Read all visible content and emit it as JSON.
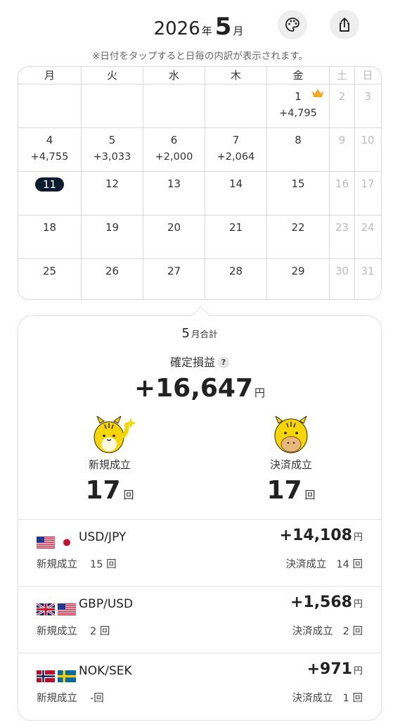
{
  "header": {
    "year": "2026",
    "year_unit": "年",
    "month": "5",
    "month_unit": "月",
    "palette_icon": "palette-icon",
    "share_icon": "share-icon",
    "note": "※日付をタップすると日毎の内訳が表示されます。"
  },
  "calendar": {
    "weekdays": [
      "月",
      "火",
      "水",
      "木",
      "金",
      "土",
      "日"
    ],
    "weeks": [
      [
        {
          "day": "",
          "pnl": ""
        },
        {
          "day": "",
          "pnl": ""
        },
        {
          "day": "",
          "pnl": ""
        },
        {
          "day": "",
          "pnl": ""
        },
        {
          "day": "1",
          "pnl": "+4,795",
          "crown": true
        },
        {
          "day": "2",
          "pnl": ""
        },
        {
          "day": "3",
          "pnl": ""
        }
      ],
      [
        {
          "day": "4",
          "pnl": "+4,755"
        },
        {
          "day": "5",
          "pnl": "+3,033"
        },
        {
          "day": "6",
          "pnl": "+2,000"
        },
        {
          "day": "7",
          "pnl": "+2,064"
        },
        {
          "day": "8",
          "pnl": ""
        },
        {
          "day": "9",
          "pnl": ""
        },
        {
          "day": "10",
          "pnl": ""
        }
      ],
      [
        {
          "day": "11",
          "pnl": "",
          "today": true
        },
        {
          "day": "12",
          "pnl": ""
        },
        {
          "day": "13",
          "pnl": ""
        },
        {
          "day": "14",
          "pnl": ""
        },
        {
          "day": "15",
          "pnl": ""
        },
        {
          "day": "16",
          "pnl": ""
        },
        {
          "day": "17",
          "pnl": ""
        }
      ],
      [
        {
          "day": "18",
          "pnl": ""
        },
        {
          "day": "19",
          "pnl": ""
        },
        {
          "day": "20",
          "pnl": ""
        },
        {
          "day": "21",
          "pnl": ""
        },
        {
          "day": "22",
          "pnl": ""
        },
        {
          "day": "23",
          "pnl": ""
        },
        {
          "day": "24",
          "pnl": ""
        }
      ],
      [
        {
          "day": "25",
          "pnl": ""
        },
        {
          "day": "26",
          "pnl": ""
        },
        {
          "day": "27",
          "pnl": ""
        },
        {
          "day": "28",
          "pnl": ""
        },
        {
          "day": "29",
          "pnl": ""
        },
        {
          "day": "30",
          "pnl": ""
        },
        {
          "day": "31",
          "pnl": ""
        }
      ]
    ],
    "crown_color": "#f5a623",
    "today_color": "#0d1b2e"
  },
  "summary": {
    "month": "5",
    "title_suffix": "月合計",
    "pl_label": "確定損益",
    "help_mark": "?",
    "pl_value": "+16,647",
    "pl_unit": "円",
    "new_label": "新規成立",
    "new_count": "17",
    "settle_label": "決済成立",
    "settle_count": "17",
    "count_unit": "回"
  },
  "pairs": [
    {
      "name": "USD/JPY",
      "flags": [
        "us-flag-icon",
        "jp-flag-icon"
      ],
      "profit": "+14,108",
      "unit": "円",
      "new_label": "新規成立",
      "new_count": "15",
      "settle_label": "決済成立",
      "settle_count": "14",
      "count_unit": "回"
    },
    {
      "name": "GBP/USD",
      "flags": [
        "uk-flag-icon",
        "us-flag-icon"
      ],
      "profit": "+1,568",
      "unit": "円",
      "new_label": "新規成立",
      "new_count": "2",
      "settle_label": "決済成立",
      "settle_count": "2",
      "count_unit": "回"
    },
    {
      "name": "NOK/SEK",
      "flags": [
        "no-flag-icon",
        "se-flag-icon"
      ],
      "profit": "+971",
      "unit": "円",
      "new_label": "新規成立",
      "new_count": "-",
      "settle_label": "決済成立",
      "settle_count": "1",
      "count_unit": "回"
    }
  ]
}
